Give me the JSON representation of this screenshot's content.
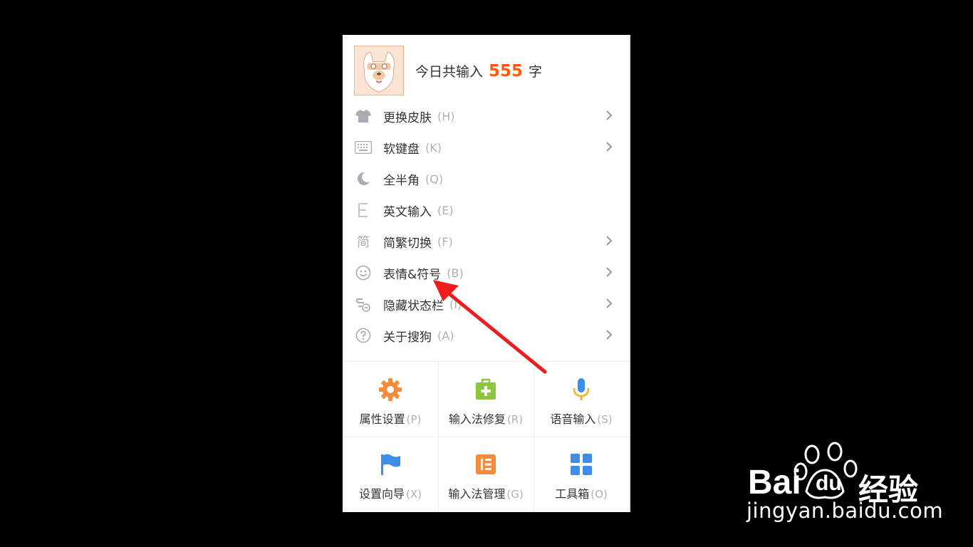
{
  "header": {
    "today_prefix": "今日共输入",
    "count": "555",
    "unit": "字"
  },
  "menu": [
    {
      "icon": "shirt-icon",
      "label": "更换皮肤",
      "key": "(H)",
      "submenu": true
    },
    {
      "icon": "keyboard-icon",
      "label": "软键盘",
      "key": "(K)",
      "submenu": true
    },
    {
      "icon": "moon-icon",
      "label": "全半角",
      "key": "(Q)",
      "submenu": false
    },
    {
      "icon": "letter-e-icon",
      "label": "英文输入",
      "key": "(E)",
      "submenu": false
    },
    {
      "icon": "simplified-char-icon",
      "icon_glyph": "简",
      "label": "简繁切换",
      "key": "(F)",
      "submenu": true
    },
    {
      "icon": "smiley-icon",
      "label": "表情&符号",
      "key": "(B)",
      "submenu": true
    },
    {
      "icon": "hide-statusbar-icon",
      "label": "隐藏状态栏",
      "key": "(I)",
      "submenu": true
    },
    {
      "icon": "question-circle-icon",
      "label": "关于搜狗",
      "key": "(A)",
      "submenu": true
    }
  ],
  "grid": [
    {
      "icon": "gear-icon",
      "label": "属性设置",
      "key": "(P)",
      "color": "#f68b3c"
    },
    {
      "icon": "repair-kit-icon",
      "label": "输入法修复",
      "key": "(R)",
      "color": "#8cc63f"
    },
    {
      "icon": "microphone-icon",
      "label": "语音输入",
      "key": "(S)",
      "color": "#3d8ee8"
    },
    {
      "icon": "flag-icon",
      "label": "设置向导",
      "key": "(X)",
      "color": "#3d8ee8"
    },
    {
      "icon": "ime-manage-icon",
      "label": "输入法管理",
      "key": "(G)",
      "color": "#f68b3c"
    },
    {
      "icon": "toolbox-icon",
      "label": "工具箱",
      "key": "(O)",
      "color": "#3d8ee8"
    }
  ],
  "watermark": {
    "brand": "Bai",
    "brand2": "du",
    "suffix": "经验",
    "url": "jingyan.baidu.com"
  },
  "colors": {
    "accent": "#ff5a14",
    "annotation_arrow": "#ee1c1c"
  }
}
